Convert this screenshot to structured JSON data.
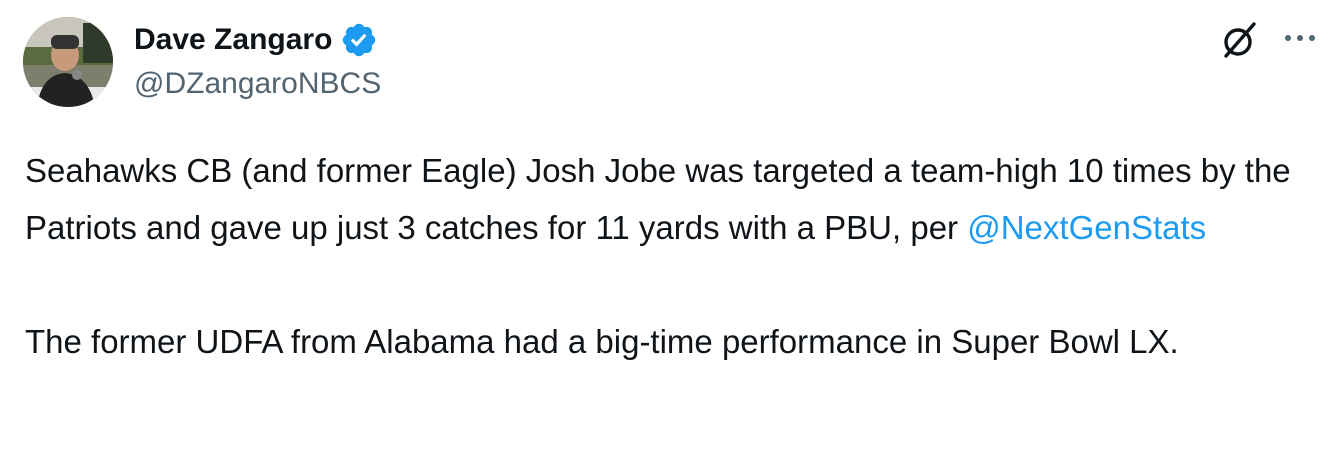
{
  "author": {
    "display_name": "Dave Zangaro",
    "handle": "@DZangaroNBCS",
    "verified": true,
    "verified_color": "#1d9bf0",
    "avatar_icon": "profile-photo"
  },
  "actions": {
    "grok_icon": "grok-icon",
    "more_icon": "more-icon"
  },
  "tweet": {
    "line_1_before": "Seahawks CB (and former Eagle) Josh Jobe was targeted a team-high 10 times by the Patriots and gave up just 3 catches for 11 yards with a PBU, per ",
    "mention": "@NextGenStats",
    "paragraph_2": "The former UDFA from Alabama had a big-time performance in Super Bowl LX."
  },
  "colors": {
    "text": "#0f1419",
    "secondary": "#536471",
    "link": "#1d9bf0"
  }
}
